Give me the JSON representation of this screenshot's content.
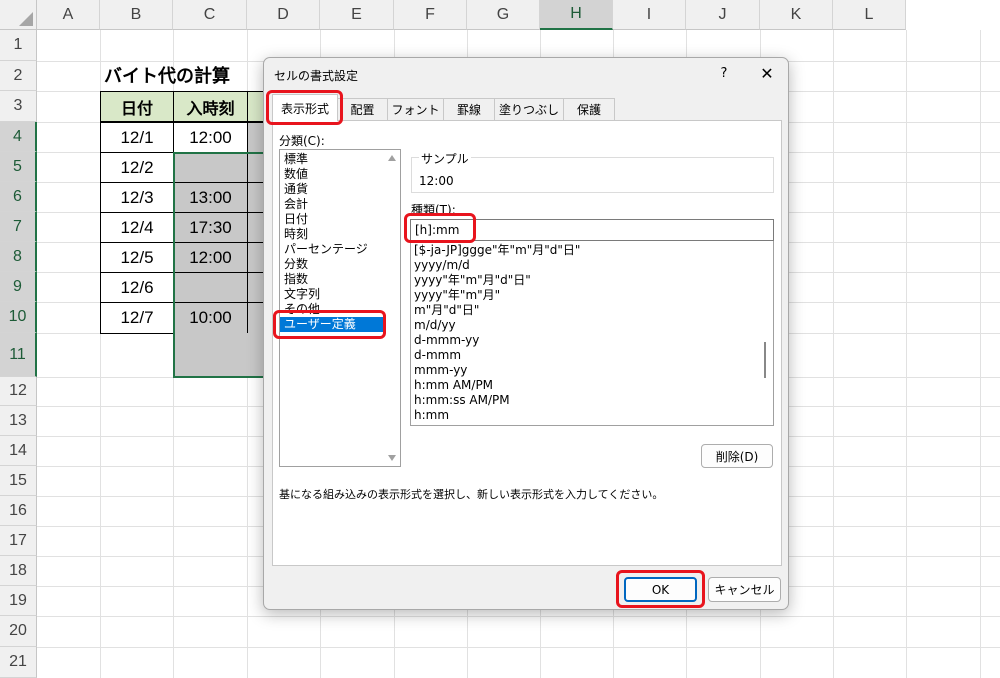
{
  "sheet": {
    "columns": [
      "A",
      "B",
      "C",
      "D",
      "E",
      "F",
      "G",
      "H",
      "I",
      "J",
      "K",
      "L"
    ],
    "selected_column": "H",
    "rows": [
      "1",
      "2",
      "3",
      "4",
      "5",
      "6",
      "7",
      "8",
      "9",
      "10",
      "11",
      "12",
      "13",
      "14",
      "15",
      "16",
      "17",
      "18",
      "19",
      "20",
      "21"
    ],
    "title": "バイト代の計算",
    "table_headers": [
      "日付",
      "入時刻"
    ],
    "dates": [
      "12/1",
      "12/2",
      "12/3",
      "12/4",
      "12/5",
      "12/6",
      "12/7"
    ],
    "entry_times": [
      "12:00",
      "",
      "13:00",
      "17:30",
      "12:00",
      "",
      "10:00"
    ],
    "accent": "#217346",
    "header_fill": "#d9e8c8"
  },
  "dialog": {
    "title": "セルの書式設定",
    "help_label": "?",
    "close_label": "✕",
    "tabs": [
      "表示形式",
      "配置",
      "フォント",
      "罫線",
      "塗りつぶし",
      "保護"
    ],
    "active_tab": "表示形式",
    "category_label": "分類(C):",
    "categories": [
      "標準",
      "数値",
      "通貨",
      "会計",
      "日付",
      "時刻",
      "パーセンテージ",
      "分数",
      "指数",
      "文字列",
      "その他",
      "ユーザー定義"
    ],
    "selected_category": "ユーザー定義",
    "sample_label": "サンプル",
    "sample_value": "12:00",
    "type_label": "種類(T):",
    "type_value": "[h]:mm",
    "formats": [
      "[$-ja-JP]ggge\"年\"m\"月\"d\"日\"",
      "yyyy/m/d",
      "yyyy\"年\"m\"月\"d\"日\"",
      "yyyy\"年\"m\"月\"",
      "m\"月\"d\"日\"",
      "m/d/yy",
      "d-mmm-yy",
      "d-mmm",
      "mmm-yy",
      "h:mm AM/PM",
      "h:mm:ss AM/PM",
      "h:mm"
    ],
    "delete_label": "削除(D)",
    "description": "基になる組み込みの表示形式を選択し、新しい表示形式を入力してください。",
    "ok_label": "OK",
    "cancel_label": "キャンセル",
    "highlight_color": "#e8141d"
  }
}
